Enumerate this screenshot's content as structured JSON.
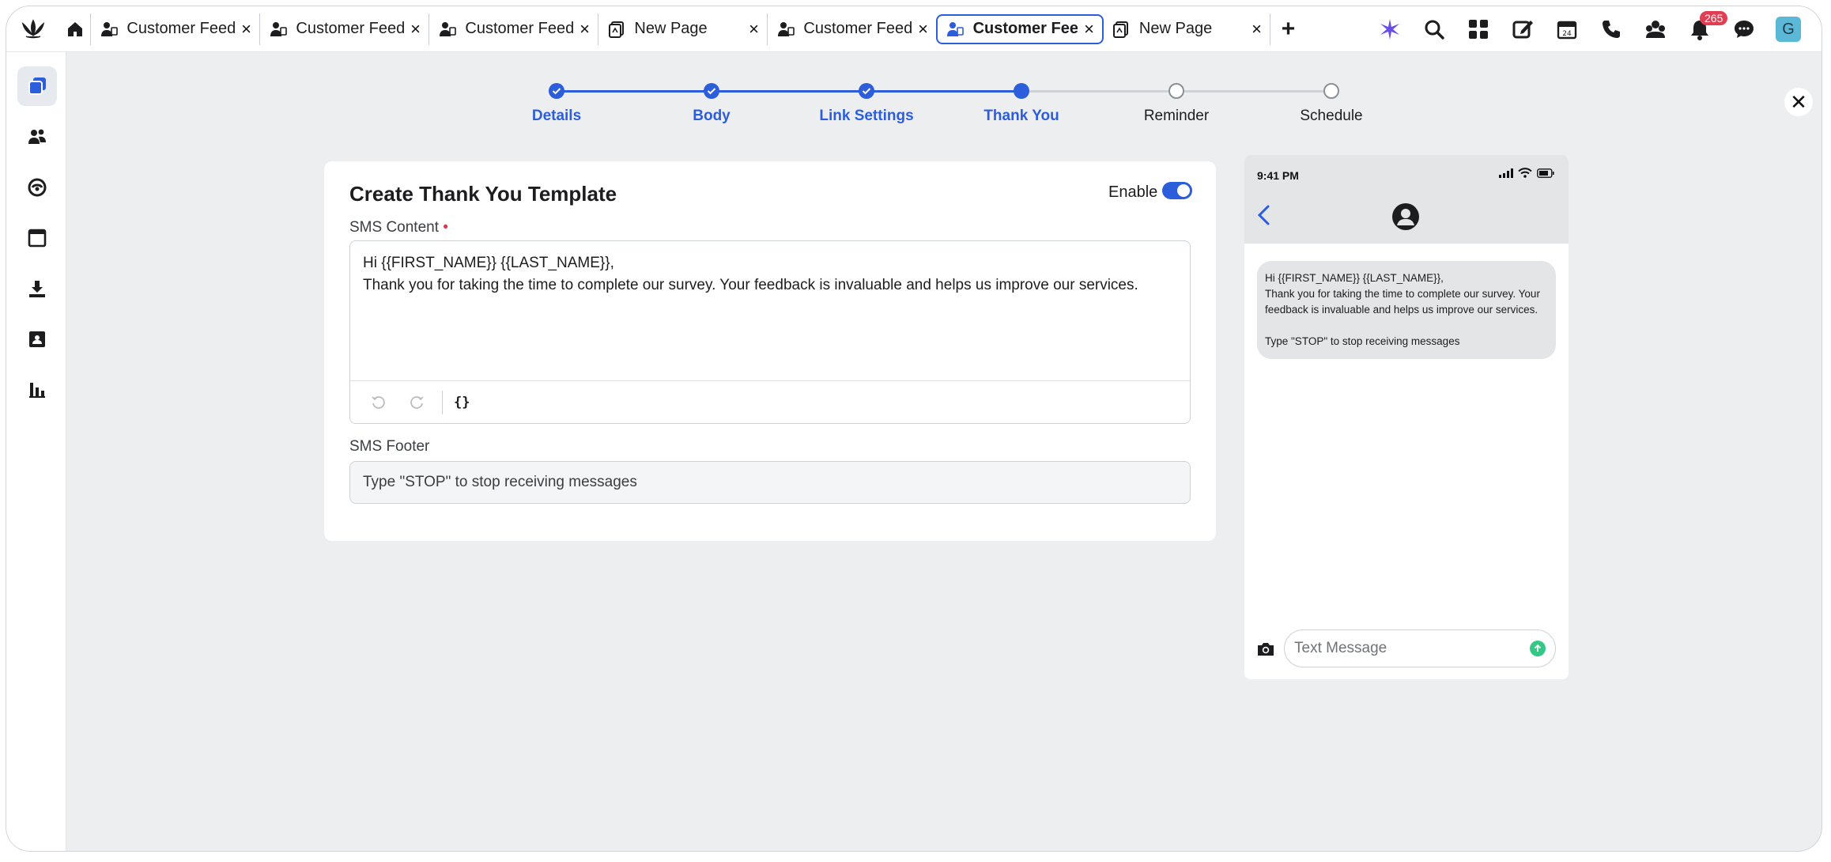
{
  "tabs": [
    {
      "label": "Customer Feedb",
      "icon": "survey-person-icon",
      "closable": true,
      "active": false
    },
    {
      "label": "Customer Feedb",
      "icon": "survey-person-icon",
      "closable": true,
      "active": false
    },
    {
      "label": "Customer Feedb",
      "icon": "survey-person-icon",
      "closable": true,
      "active": false
    },
    {
      "label": "New Page",
      "icon": "page-icon",
      "closable": true,
      "active": false
    },
    {
      "label": "Customer Feedb",
      "icon": "survey-person-icon",
      "closable": true,
      "active": false
    },
    {
      "label": "Customer Feed",
      "icon": "survey-person-icon",
      "closable": true,
      "active": true
    },
    {
      "label": "New Page",
      "icon": "page-icon",
      "closable": true,
      "active": false
    }
  ],
  "tab_close_glyph": "×",
  "new_tab_glyph": "+",
  "notifications": {
    "count": "265"
  },
  "user": {
    "avatar_initial": "G"
  },
  "stepper": {
    "steps": [
      {
        "label": "Details",
        "state": "done"
      },
      {
        "label": "Body",
        "state": "done"
      },
      {
        "label": "Link Settings",
        "state": "done"
      },
      {
        "label": "Thank You",
        "state": "current"
      },
      {
        "label": "Reminder",
        "state": "todo"
      },
      {
        "label": "Schedule",
        "state": "todo"
      }
    ]
  },
  "close_glyph": "✕",
  "form": {
    "title": "Create Thank You Template",
    "enable_label": "Enable",
    "enabled": true,
    "sms_content_label": "SMS Content",
    "required_marker": "•",
    "sms_content_value": "Hi {{FIRST_NAME}} {{LAST_NAME}},\nThank you for taking the time to complete our survey. Your feedback is invaluable and helps us improve our services.",
    "variable_button": "{}",
    "sms_footer_label": "SMS Footer",
    "sms_footer_value": "Type \"STOP\" to stop receiving messages"
  },
  "preview": {
    "time": "9:41 PM",
    "message": "Hi {{FIRST_NAME}} {{LAST_NAME}},\nThank you for taking the time to complete our survey. Your feedback is invaluable and helps us improve our services.\n\nType \"STOP\" to stop receiving messages",
    "input_placeholder": "Text Message"
  },
  "colors": {
    "accent": "#2c5ddb",
    "badge": "#e03e52",
    "send": "#34c785"
  }
}
